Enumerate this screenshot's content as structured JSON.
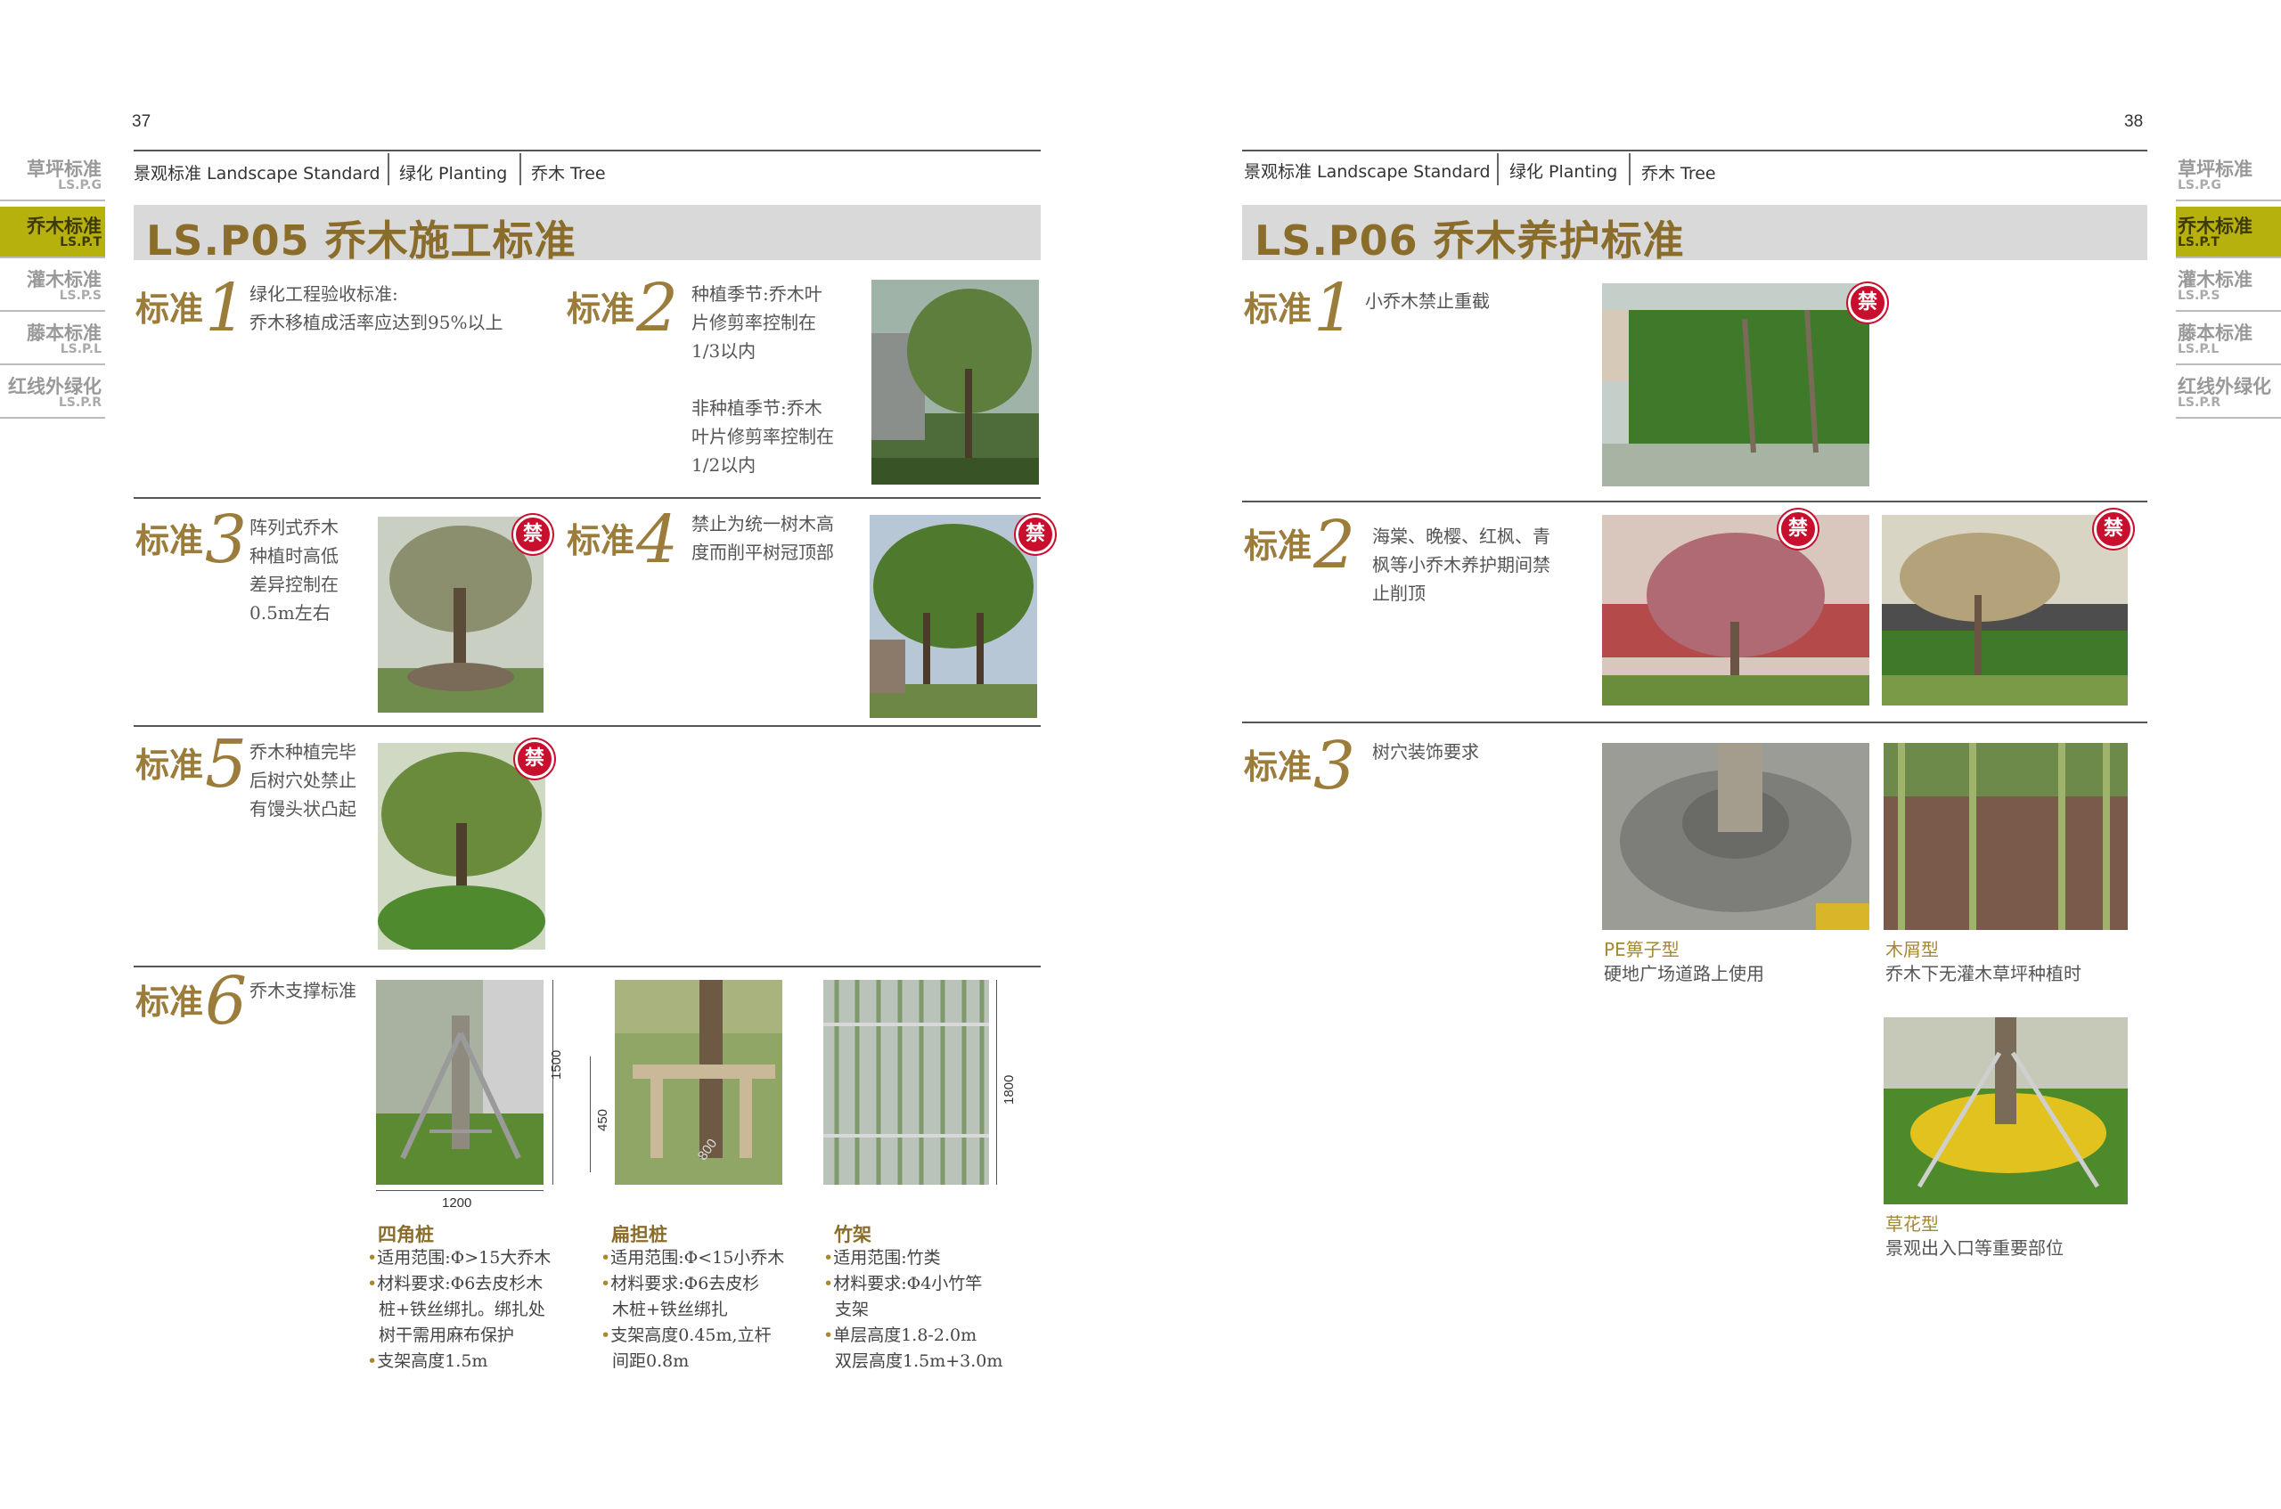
{
  "left_page": {
    "page_number": "37",
    "breadcrumb": [
      "景观标准 Landscape Standard",
      "绿化 Planting",
      "乔木 Tree"
    ],
    "title": "LS.P05  乔木施工标准",
    "standard_word": "标准",
    "s1": {
      "num": "1",
      "lines": [
        "绿化工程验收标准:",
        "乔木移植成活率应达到95%以上"
      ]
    },
    "s2": {
      "num": "2",
      "lines": [
        "种植季节:乔木叶",
        "片修剪率控制在",
        "1/3以内",
        "",
        "非种植季节:乔木",
        "叶片修剪率控制在",
        "1/2以内"
      ]
    },
    "s3": {
      "num": "3",
      "lines": [
        "阵列式乔木",
        "种植时高低",
        "差异控制在",
        "0.5m左右"
      ]
    },
    "s4": {
      "num": "4",
      "lines": [
        "禁止为统一树木高",
        "度而削平树冠顶部"
      ]
    },
    "s5": {
      "num": "5",
      "lines": [
        "乔木种植完毕",
        "后树穴处禁止",
        "有馒头状凸起"
      ]
    },
    "s6": {
      "num": "6",
      "lines": [
        "乔木支撑标准"
      ]
    },
    "ban_label": "禁",
    "supports": [
      {
        "name": "四角桩",
        "dim_w": "1200",
        "dim_h": "1500",
        "bullets": [
          [
            "•",
            "适用范围:Φ>15大乔木"
          ],
          [
            "•",
            "材料要求:Φ6去皮杉木"
          ],
          [
            "",
            "桩+铁丝绑扎。绑扎处"
          ],
          [
            "",
            "树干需用麻布保护"
          ],
          [
            "•",
            "支架高度1.5m"
          ]
        ]
      },
      {
        "name": "扁担桩",
        "dim_h": "450",
        "dim_d": "800",
        "bullets": [
          [
            "•",
            "适用范围:Φ<15小乔木"
          ],
          [
            "•",
            "材料要求:Φ6去皮杉"
          ],
          [
            "",
            "木桩+铁丝绑扎"
          ],
          [
            "•",
            "支架高度0.45m,立杆"
          ],
          [
            "",
            "间距0.8m"
          ]
        ]
      },
      {
        "name": "竹架",
        "dim_h": "1800",
        "bullets": [
          [
            "•",
            "适用范围:竹类"
          ],
          [
            "•",
            "材料要求:Φ4小竹竿"
          ],
          [
            "",
            "支架"
          ],
          [
            "•",
            "单层高度1.8-2.0m"
          ],
          [
            "",
            "双层高度1.5m+3.0m"
          ]
        ]
      }
    ]
  },
  "right_page": {
    "page_number": "38",
    "breadcrumb": [
      "景观标准 Landscape Standard",
      "绿化 Planting",
      "乔木 Tree"
    ],
    "title": "LS.P06  乔木养护标准",
    "s1": {
      "num": "1",
      "lines": [
        "小乔木禁止重截"
      ]
    },
    "s2": {
      "num": "2",
      "lines": [
        "海棠、晚樱、红枫、青",
        "枫等小乔木养护期间禁",
        "止削顶"
      ]
    },
    "s3": {
      "num": "3",
      "lines": [
        "树穴装饰要求"
      ]
    },
    "pit_types": [
      {
        "name": "PE箅子型",
        "desc": "硬地广场道路上使用"
      },
      {
        "name": "木屑型",
        "desc": "乔木下无灌木草坪种植时"
      },
      {
        "name": "草花型",
        "desc": "景观出入口等重要部位"
      }
    ]
  },
  "sidebar": [
    {
      "zh": "草坪标准",
      "en": "LS.P.G",
      "active": false
    },
    {
      "zh": "乔木标准",
      "en": "LS.P.T",
      "active": true
    },
    {
      "zh": "灌木标准",
      "en": "LS.P.S",
      "active": false
    },
    {
      "zh": "藤本标准",
      "en": "LS.P.L",
      "active": false
    },
    {
      "zh": "红线外绿化",
      "en": "LS.P.R",
      "active": false
    }
  ],
  "colors": {
    "accent": "#9c7c3a",
    "sidebar_active": "#b7b10d",
    "ban": "#c8102e",
    "title_bar": "#d9d9d9"
  }
}
